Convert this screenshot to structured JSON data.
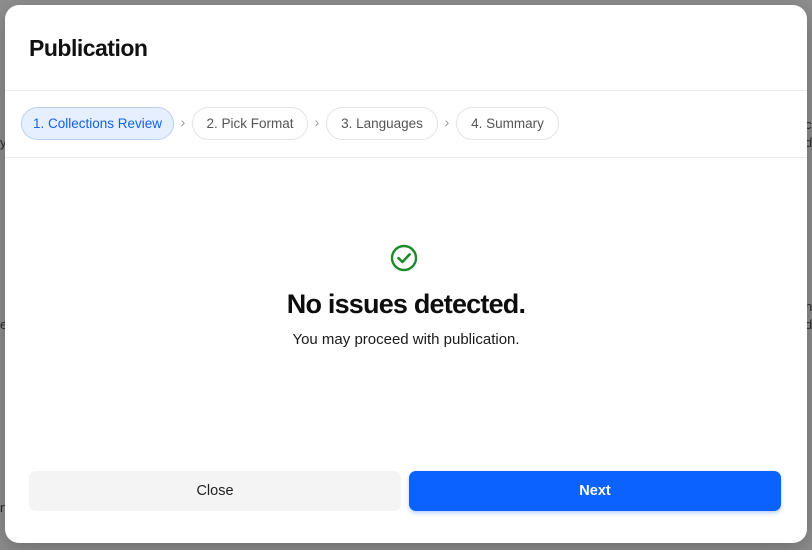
{
  "background": {
    "fragments": [
      "c",
      "d",
      "n",
      "d",
      "y",
      "e",
      "n"
    ]
  },
  "modal": {
    "title": "Publication",
    "steps": [
      {
        "label": "1. Collections Review",
        "active": true
      },
      {
        "label": "2. Pick Format",
        "active": false
      },
      {
        "label": "3. Languages",
        "active": false
      },
      {
        "label": "4. Summary",
        "active": false
      }
    ],
    "status": {
      "icon": "check-circle-icon",
      "headline": "No issues detected.",
      "message": "You may proceed with publication."
    },
    "footer": {
      "close_label": "Close",
      "next_label": "Next"
    }
  },
  "colors": {
    "accent": "#0b62ff",
    "success": "#1e8a2c",
    "active_step_bg": "#e5efff",
    "active_step_text": "#1463e6"
  }
}
